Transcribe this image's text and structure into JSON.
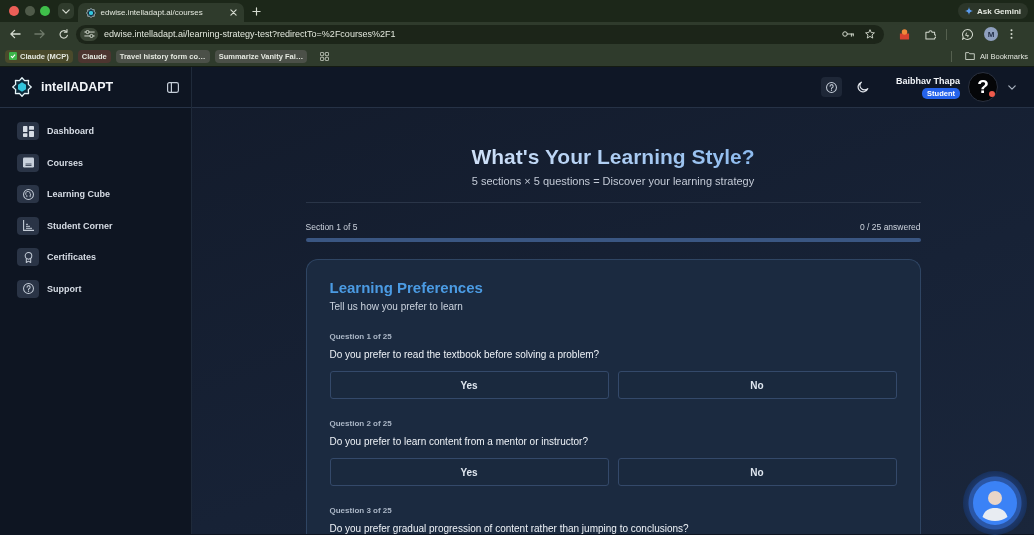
{
  "browser": {
    "tabs": [
      {
        "title": "edwise.intelladapt.ai/courses",
        "selected": true
      }
    ],
    "ask_button": "Ask Gemini",
    "url": "edwise.intelladapt.ai/learning-strategy-test?redirectTo=%2Fcourses%2F1",
    "profile_initial": "M",
    "bookmarks": [
      {
        "label": "Claude (MCP)",
        "kind": "icon",
        "color": "#4a4a2b"
      },
      {
        "label": "Claude",
        "kind": "text",
        "color": "#4d3530"
      },
      {
        "label": "Travel history form co…",
        "kind": "text",
        "color": "#4b5048"
      },
      {
        "label": "Summarize Vanity Fai…",
        "kind": "text",
        "color": "#4b5048"
      }
    ],
    "all_bookmarks": "All Bookmarks"
  },
  "app": {
    "brand": "intellADAPT",
    "nav": [
      {
        "label": "Dashboard",
        "selected": false
      },
      {
        "label": "Courses",
        "selected": false
      },
      {
        "label": "Learning Cube",
        "selected": false
      },
      {
        "label": "Student Corner",
        "selected": false
      },
      {
        "label": "Certificates",
        "selected": false
      },
      {
        "label": "Support",
        "selected": false
      }
    ],
    "user": {
      "name": "Baibhav Thapa",
      "role": "Student",
      "avatar_glyph": "?"
    }
  },
  "quiz": {
    "title": "What's Your Learning Style?",
    "subtitle": "5 sections × 5 questions = Discover your learning strategy",
    "section": "Section 1 of 5",
    "answered": "0 / 25 answered",
    "progress": {
      "level": 0
    },
    "card": {
      "title": "Learning Preferences",
      "subtitle": "Tell us how you prefer to learn",
      "questions": [
        {
          "number": "Question 1 of 25",
          "text": "Do you prefer to read the textbook before solving a problem?",
          "options": [
            {
              "label": "Yes",
              "selected": false
            },
            {
              "label": "No",
              "selected": false
            }
          ]
        },
        {
          "number": "Question 2 of 25",
          "text": "Do you prefer to learn content from a mentor or instructor?",
          "options": [
            {
              "label": "Yes",
              "selected": false
            },
            {
              "label": "No",
              "selected": false
            }
          ]
        },
        {
          "number": "Question 3 of 25",
          "text": "Do you prefer gradual progression of content rather than jumping to conclusions?"
        }
      ]
    }
  }
}
